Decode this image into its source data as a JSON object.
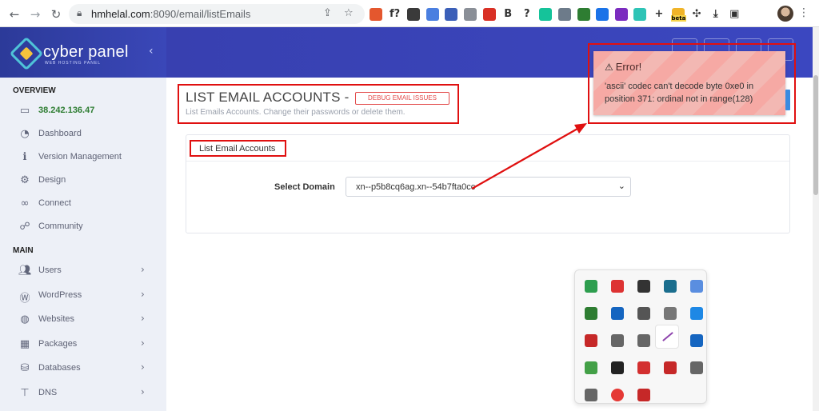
{
  "browser": {
    "url_host": "hmhelal.com",
    "url_path": ":8090/email/listEmails",
    "extensions": [
      {
        "name": "highlighter-ext-icon",
        "color": "#e4572e",
        "glyph": ""
      },
      {
        "name": "formula-ext-icon",
        "color": "transparent",
        "glyph": "f?"
      },
      {
        "name": "hb-ext-icon",
        "color": "#3a3a3a",
        "glyph": ""
      },
      {
        "name": "translate-ext-icon",
        "color": "#4a7fe0",
        "glyph": ""
      },
      {
        "name": "color-picker-ext-icon",
        "color": "#3b5fb8",
        "glyph": ""
      },
      {
        "name": "camera-ext-icon",
        "color": "#8a8f97",
        "glyph": ""
      },
      {
        "name": "shield-ext-icon",
        "color": "#d93025",
        "glyph": ""
      },
      {
        "name": "bold-b-ext-icon",
        "color": "transparent",
        "glyph": "B"
      },
      {
        "name": "question-ext-icon",
        "color": "transparent",
        "glyph": "?"
      },
      {
        "name": "grammarly-ext-icon",
        "color": "#15c39a",
        "glyph": ""
      },
      {
        "name": "screen-ext-icon",
        "color": "#6d7b8a",
        "glyph": ""
      },
      {
        "name": "globe-ext-icon",
        "color": "#2e7d32",
        "glyph": ""
      },
      {
        "name": "search-ext-icon",
        "color": "#1a73e8",
        "glyph": ""
      },
      {
        "name": "w-ext-icon",
        "color": "#7b2cbf",
        "glyph": ""
      },
      {
        "name": "n-ext-icon",
        "color": "#2ec4b6",
        "glyph": ""
      },
      {
        "name": "plus-ext-icon",
        "color": "transparent",
        "glyph": "+"
      },
      {
        "name": "beta-ext-icon",
        "color": "#f0b429",
        "glyph": ""
      },
      {
        "name": "puzzle-ext-icon",
        "color": "transparent",
        "glyph": ""
      },
      {
        "name": "download-ext-icon",
        "color": "transparent",
        "glyph": ""
      },
      {
        "name": "sidebar-ext-icon",
        "color": "transparent",
        "glyph": ""
      }
    ],
    "beta_badge": "beta"
  },
  "brand": {
    "name": "cyber panel",
    "tagline": "WEB HOSTING PANEL"
  },
  "sidebar": {
    "overview_label": "OVERVIEW",
    "main_label": "MAIN",
    "overview_items": [
      {
        "label": "38.242.136.47",
        "icon": "laptop-icon"
      },
      {
        "label": "Dashboard",
        "icon": "dashboard-icon"
      },
      {
        "label": "Version Management",
        "icon": "info-icon"
      },
      {
        "label": "Design",
        "icon": "gear-icon"
      },
      {
        "label": "Connect",
        "icon": "link-icon"
      },
      {
        "label": "Community",
        "icon": "community-icon"
      }
    ],
    "main_items": [
      {
        "label": "Users",
        "icon": "users-icon"
      },
      {
        "label": "WordPress",
        "icon": "wordpress-icon"
      },
      {
        "label": "Websites",
        "icon": "globe-icon"
      },
      {
        "label": "Packages",
        "icon": "packages-icon"
      },
      {
        "label": "Databases",
        "icon": "database-icon"
      },
      {
        "label": "DNS",
        "icon": "sitemap-icon"
      }
    ]
  },
  "content": {
    "title": "LIST EMAIL ACCOUNTS -",
    "debug_button": "DEBUG EMAIL ISSUES",
    "subtitle": "List Emails Accounts. Change their passwords or delete them.",
    "card_title": "List Email Accounts",
    "select_label": "Select Domain",
    "select_value": "xn--p5b8cq6ag.xn--54b7fta0cc"
  },
  "error_toast": {
    "title": "Error!",
    "message": "'ascii' codec can't decode byte 0xe0 in position 371: ordinal not in range(128)"
  },
  "colors": {
    "header": "#3a44b8",
    "annotation": "#e01010",
    "toast": "#f6a9a4"
  }
}
